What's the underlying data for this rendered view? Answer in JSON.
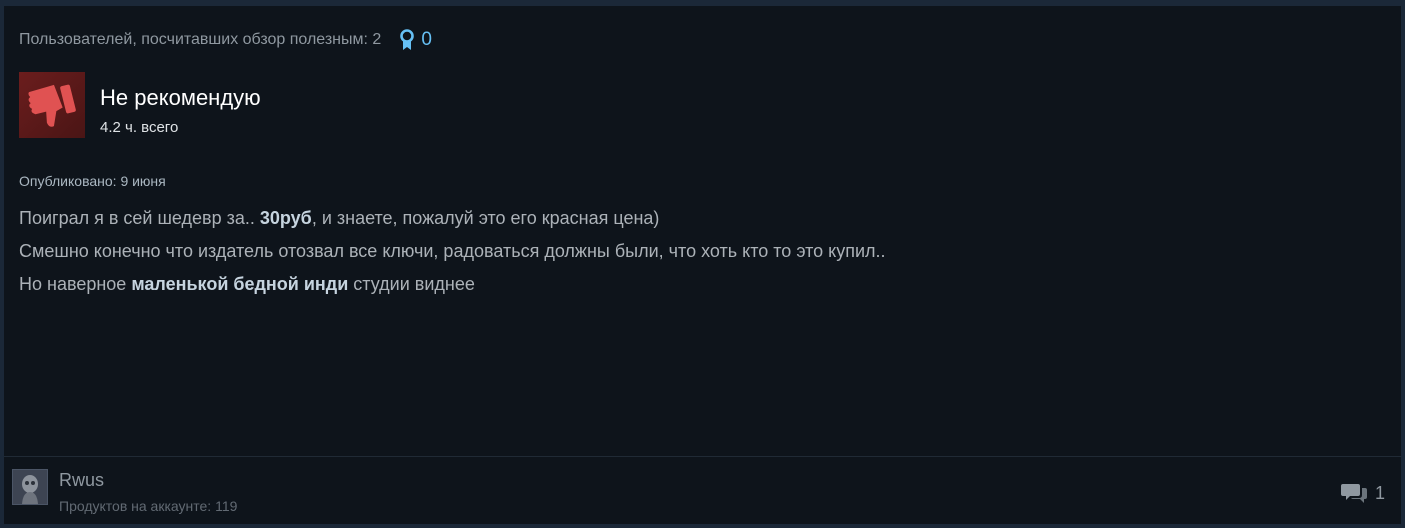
{
  "helpful": {
    "text": "Пользователей, посчитавших обзор полезным: 2",
    "awards_count": "0"
  },
  "vote": {
    "title": "Не рекомендую",
    "hours": "4.2 ч. всего",
    "icon": "thumbs-down-icon"
  },
  "review": {
    "posted": "Опубликовано: 9 июня",
    "lines": [
      {
        "before": "Поиграл я в сей шедевр за.. ",
        "bold": "30руб",
        "after": ", и знаете, пожалуй это его красная цена)"
      },
      {
        "text": "Смешно конечно что издатель отозвал все ключи, радоваться должны были, что хоть кто то это купил.."
      },
      {
        "before": "Но наверное ",
        "bold": "маленькой бедной инди",
        "after": " студии виднее"
      }
    ]
  },
  "author": {
    "name": "Rwus",
    "products": "Продуктов на аккаунте: 119"
  },
  "comments": {
    "count": "1"
  },
  "colors": {
    "card_bg": "#0e141b",
    "page_bg": "#1b2838",
    "accent_blue": "#66c0f4",
    "thumb_red": "#e05252"
  }
}
